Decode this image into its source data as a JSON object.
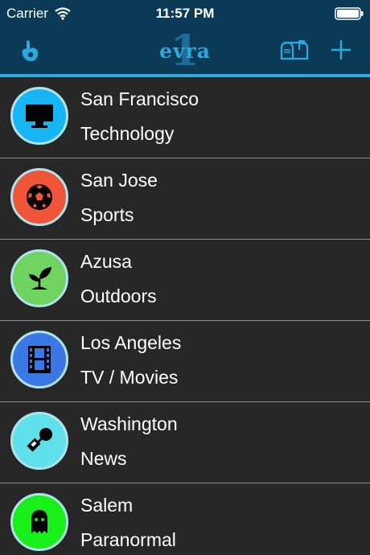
{
  "status_bar": {
    "carrier": "Carrier",
    "time": "11:57 PM"
  },
  "nav": {
    "logo_text": "evra",
    "logo_numeral": "1",
    "icons": [
      "hand-icon",
      "mailbox-icon",
      "plus-icon"
    ]
  },
  "colors": {
    "nav_background": "#0b3a57",
    "accent": "#29a9e0",
    "list_background": "#272727"
  },
  "channels": [
    {
      "city": "San Francisco",
      "category": "Technology",
      "icon": "monitor-icon",
      "color": "#16b5f3"
    },
    {
      "city": "San Jose",
      "category": "Sports",
      "icon": "soccer-ball-icon",
      "color": "#f0553a"
    },
    {
      "city": "Azusa",
      "category": "Outdoors",
      "icon": "seedling-icon",
      "color": "#6fd45f"
    },
    {
      "city": "Los Angeles",
      "category": "TV / Movies",
      "icon": "film-strip-icon",
      "color": "#3a78e6"
    },
    {
      "city": "Washington",
      "category": "News",
      "icon": "microphone-icon",
      "color": "#5fe0ea"
    },
    {
      "city": "Salem",
      "category": "Paranormal",
      "icon": "ghost-icon",
      "color": "#18ee18"
    }
  ]
}
